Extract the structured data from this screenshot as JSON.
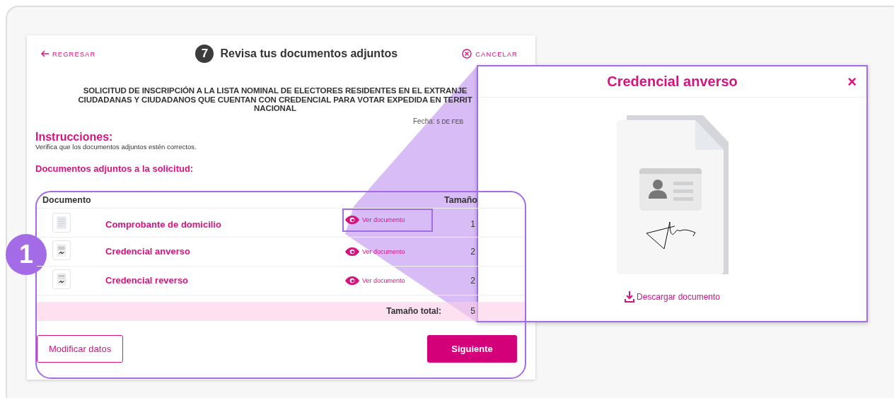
{
  "header": {
    "back": "REGRESAR",
    "step": "7",
    "title": "Revisa tus documentos adjuntos",
    "cancel": "CANCELAR"
  },
  "form_title": [
    "SOLICITUD DE INSCRIPCIÓN A LA LISTA NOMINAL DE ELECTORES RESIDENTES EN EL EXTRANJE",
    "CIUDADANAS Y CIUDADANOS QUE CUENTAN CON CREDENCIAL PARA VOTAR EXPEDIDA EN TERRIT",
    "NACIONAL"
  ],
  "date": {
    "label": "Fecha:",
    "value": "5 DE FEB"
  },
  "instructions": {
    "heading": "Instrucciones:",
    "text": "Verifica que los documentos adjuntos estén correctos."
  },
  "section_heading": "Documentos adjuntos a la solicitud:",
  "table": {
    "columns": [
      "Documento",
      "Tamaño"
    ],
    "rows": [
      {
        "kind": "plain",
        "name": "Comprobante de domicilio",
        "action": "Ver documento",
        "size": "1",
        "highlighted": true
      },
      {
        "kind": "id_front",
        "name": "Credencial anverso",
        "action": "Ver documento",
        "size": "2",
        "highlighted": false
      },
      {
        "kind": "id_back",
        "name": "Credencial reverso",
        "action": "Ver documento",
        "size": "2",
        "highlighted": false
      }
    ],
    "total_label": "Tamaño total:",
    "total": "5"
  },
  "buttons": [
    {
      "kind": "outline",
      "label": "Modificar datos"
    },
    {
      "kind": "primary",
      "label": "Siguiente"
    }
  ],
  "callout": {
    "number": "1"
  },
  "modal": {
    "title": "Credencial anverso",
    "close": "×",
    "download": "Descargar documento"
  }
}
